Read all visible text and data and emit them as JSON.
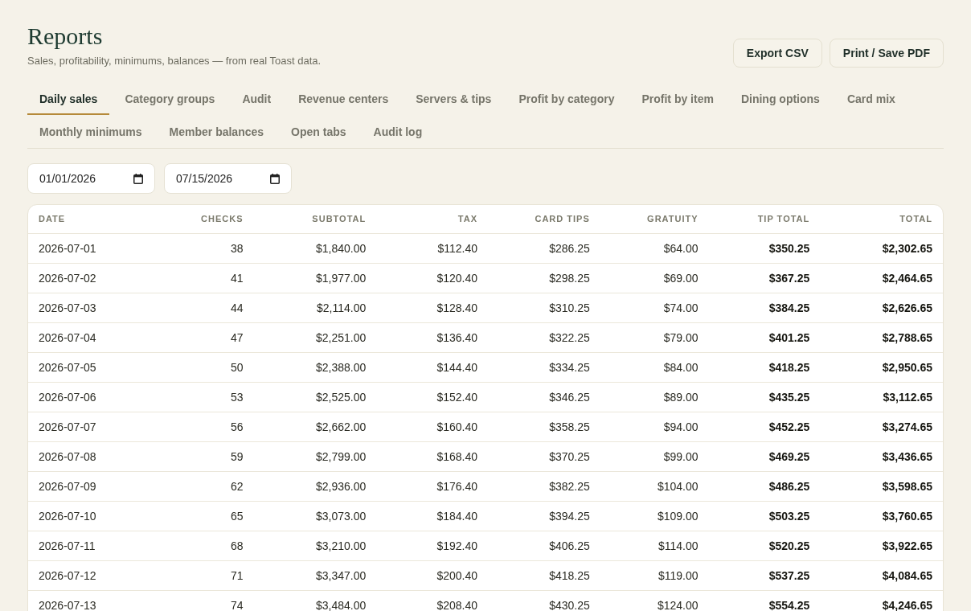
{
  "header": {
    "title": "Reports",
    "subtitle": "Sales, profitability, minimums, balances — from real Toast data.",
    "buttons": [
      {
        "label": "Export CSV"
      },
      {
        "label": "Print / Save PDF"
      }
    ]
  },
  "tabs": [
    {
      "label": "Daily sales",
      "selected": true
    },
    {
      "label": "Category groups",
      "selected": false
    },
    {
      "label": "Audit",
      "selected": false
    },
    {
      "label": "Revenue centers",
      "selected": false
    },
    {
      "label": "Servers & tips",
      "selected": false
    },
    {
      "label": "Profit by category",
      "selected": false
    },
    {
      "label": "Profit by item",
      "selected": false
    },
    {
      "label": "Dining options",
      "selected": false
    },
    {
      "label": "Card mix",
      "selected": false
    },
    {
      "label": "Monthly minimums",
      "selected": false
    },
    {
      "label": "Member balances",
      "selected": false
    },
    {
      "label": "Open tabs",
      "selected": false
    },
    {
      "label": "Audit log",
      "selected": false
    }
  ],
  "filters": {
    "date_fields": [
      {
        "value": "01/01/2026"
      },
      {
        "value": "07/15/2026"
      }
    ]
  },
  "table": {
    "columns": [
      {
        "label": "DATE",
        "kind": "date"
      },
      {
        "label": "CHECKS",
        "kind": "count"
      },
      {
        "label": "SUBTOTAL",
        "kind": "money"
      },
      {
        "label": "TAX",
        "kind": "money"
      },
      {
        "label": "CARD TIPS",
        "kind": "money"
      },
      {
        "label": "GRATUITY",
        "kind": "money"
      },
      {
        "label": "TIP TOTAL",
        "kind": "total"
      },
      {
        "label": "TOTAL",
        "kind": "total"
      }
    ],
    "rows": [
      [
        "2026-07-01",
        "38",
        "$1,840.00",
        "$112.40",
        "$286.25",
        "$64.00",
        "$350.25",
        "$2,302.65"
      ],
      [
        "2026-07-02",
        "41",
        "$1,977.00",
        "$120.40",
        "$298.25",
        "$69.00",
        "$367.25",
        "$2,464.65"
      ],
      [
        "2026-07-03",
        "44",
        "$2,114.00",
        "$128.40",
        "$310.25",
        "$74.00",
        "$384.25",
        "$2,626.65"
      ],
      [
        "2026-07-04",
        "47",
        "$2,251.00",
        "$136.40",
        "$322.25",
        "$79.00",
        "$401.25",
        "$2,788.65"
      ],
      [
        "2026-07-05",
        "50",
        "$2,388.00",
        "$144.40",
        "$334.25",
        "$84.00",
        "$418.25",
        "$2,950.65"
      ],
      [
        "2026-07-06",
        "53",
        "$2,525.00",
        "$152.40",
        "$346.25",
        "$89.00",
        "$435.25",
        "$3,112.65"
      ],
      [
        "2026-07-07",
        "56",
        "$2,662.00",
        "$160.40",
        "$358.25",
        "$94.00",
        "$452.25",
        "$3,274.65"
      ],
      [
        "2026-07-08",
        "59",
        "$2,799.00",
        "$168.40",
        "$370.25",
        "$99.00",
        "$469.25",
        "$3,436.65"
      ],
      [
        "2026-07-09",
        "62",
        "$2,936.00",
        "$176.40",
        "$382.25",
        "$104.00",
        "$486.25",
        "$3,598.65"
      ],
      [
        "2026-07-10",
        "65",
        "$3,073.00",
        "$184.40",
        "$394.25",
        "$109.00",
        "$503.25",
        "$3,760.65"
      ],
      [
        "2026-07-11",
        "68",
        "$3,210.00",
        "$192.40",
        "$406.25",
        "$114.00",
        "$520.25",
        "$3,922.65"
      ],
      [
        "2026-07-12",
        "71",
        "$3,347.00",
        "$200.40",
        "$418.25",
        "$119.00",
        "$537.25",
        "$4,084.65"
      ],
      [
        "2026-07-13",
        "74",
        "$3,484.00",
        "$208.40",
        "$430.25",
        "$124.00",
        "$554.25",
        "$4,246.65"
      ]
    ]
  }
}
